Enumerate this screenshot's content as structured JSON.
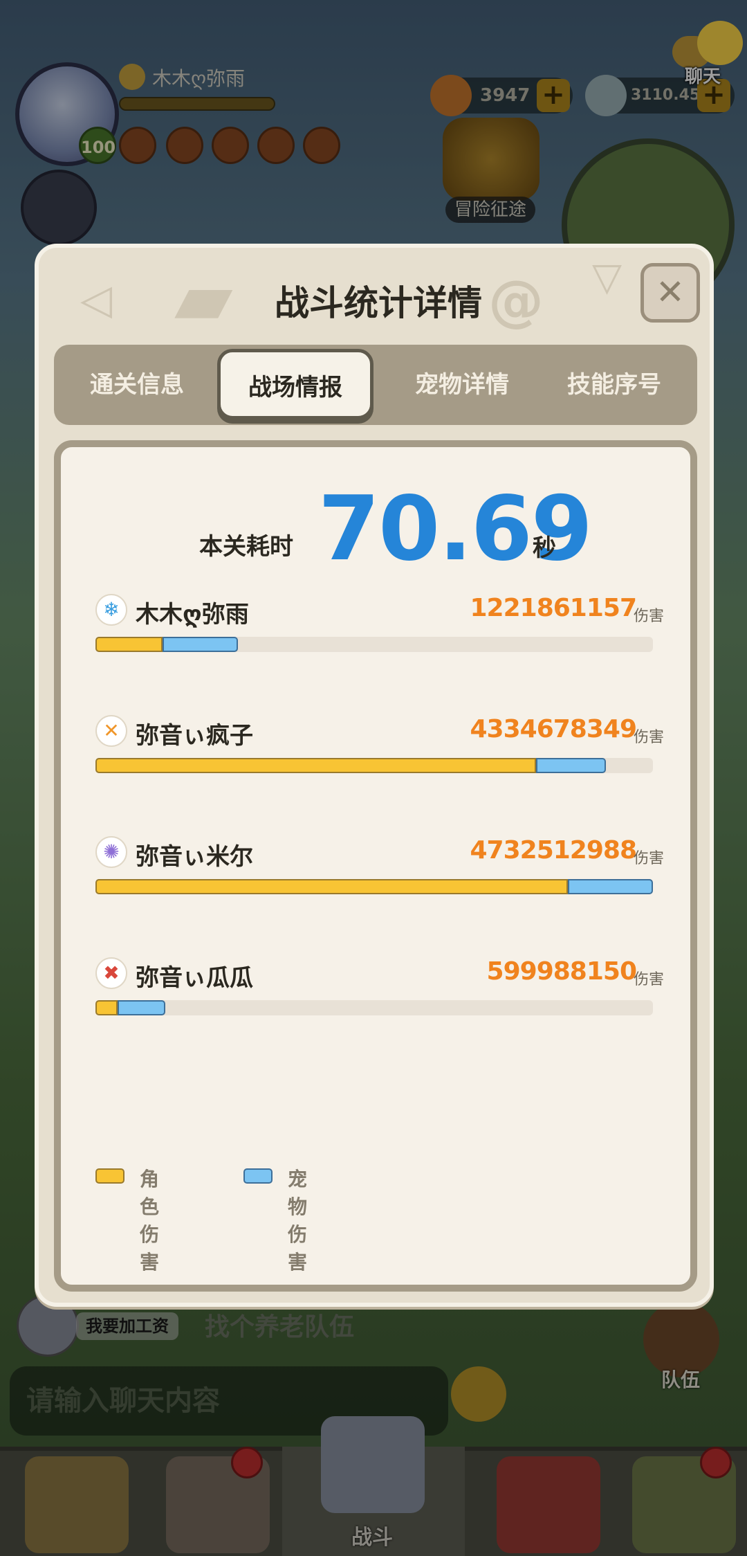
{
  "hud": {
    "player_name": "木木ღ弥雨",
    "level": "100",
    "coins": "3947",
    "gems": "3110.45M",
    "adventure_label": "冒险征途",
    "chat_label": "聊天"
  },
  "chat": {
    "sender_name": "我要加工资",
    "message": "找个养老队伍",
    "input_placeholder": "请输入聊天内容",
    "team_label": "队伍"
  },
  "bottom_nav": {
    "active_label": "战斗"
  },
  "dialog": {
    "title": "战斗统计详情",
    "close_symbol": "✕",
    "tabs": [
      {
        "label": "通关信息"
      },
      {
        "label": "战场情报"
      },
      {
        "label": "宠物详情"
      },
      {
        "label": "技能序号"
      }
    ],
    "active_tab": "战场情报",
    "time_label": "本关耗时",
    "time_value": "70.69",
    "time_unit": "秒",
    "damage_unit": "伤害",
    "players": [
      {
        "name": "木木ღ弥雨",
        "damage": "1221861157",
        "icon": "ice-class-icon",
        "icon_color": "#3a9ee0",
        "role_fraction": 0.12,
        "pet_fraction": 0.135
      },
      {
        "name": "弥音ぃ疯子",
        "damage": "4334678349",
        "icon": "sword-class-icon",
        "icon_color": "#f0962a",
        "role_fraction": 0.79,
        "pet_fraction": 0.125
      },
      {
        "name": "弥音ぃ米尔",
        "damage": "4732512988",
        "icon": "magic-class-icon",
        "icon_color": "#8e6fd6",
        "role_fraction": 0.847,
        "pet_fraction": 0.153
      },
      {
        "name": "弥音ぃ瓜瓜",
        "damage": "599988150",
        "icon": "demon-class-icon",
        "icon_color": "#d9473b",
        "role_fraction": 0.04,
        "pet_fraction": 0.085
      }
    ],
    "legend": [
      {
        "label": "角色伤害",
        "color": "#f8c434"
      },
      {
        "label": "宠物伤害",
        "color": "#7cc4f2"
      }
    ]
  }
}
